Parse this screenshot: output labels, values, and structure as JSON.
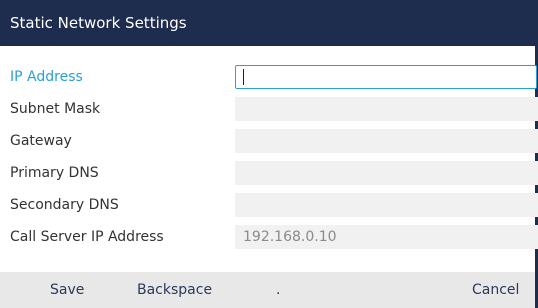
{
  "header": {
    "title": "Static Network Settings"
  },
  "fields": [
    {
      "label": "IP Address",
      "value": ""
    },
    {
      "label": "Subnet Mask",
      "value": ""
    },
    {
      "label": "Gateway",
      "value": ""
    },
    {
      "label": "Primary DNS",
      "value": ""
    },
    {
      "label": "Secondary DNS",
      "value": ""
    },
    {
      "label": "Call Server IP Address",
      "value": "192.168.0.10"
    }
  ],
  "softkeys": {
    "save": "Save",
    "backspace": "Backspace",
    "dot": ".",
    "cancel": "Cancel"
  },
  "colors": {
    "header_bg": "#1e2c4e",
    "accent": "#2aa0d8",
    "field_bg": "#f1f1f1",
    "softkey_bar": "#e8e8e8"
  }
}
